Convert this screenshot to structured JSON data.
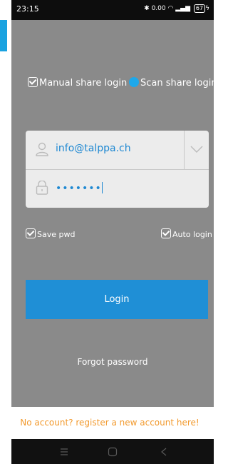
{
  "status_bar": {
    "time": "23:15",
    "speed": "0.00",
    "battery": "67"
  },
  "login_modes": {
    "manual_label": "Manual share login",
    "scan_label": "Scan share login"
  },
  "form": {
    "email_value": "info@talppa.ch",
    "password_mask": "•••••••"
  },
  "options": {
    "save_pwd_label": "Save pwd",
    "auto_login_label": "Auto login"
  },
  "buttons": {
    "login_label": "Login",
    "forgot_label": "Forgot password"
  },
  "register_text": "No account? register a new account here!",
  "colors": {
    "accent": "#1f8fd6",
    "panel": "#8a8a8a",
    "register": "#f29a2e"
  }
}
